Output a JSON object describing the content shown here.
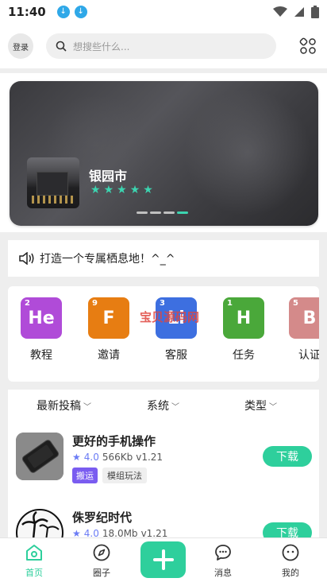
{
  "status": {
    "time": "11:40"
  },
  "header": {
    "login_label": "登录",
    "search_placeholder": "想搜些什么..."
  },
  "banner": {
    "title": "银园市",
    "stars": 5,
    "pages": 4,
    "active_page": 4
  },
  "notice": {
    "text": "打造一个专属栖息地！^_^"
  },
  "categories": [
    {
      "label": "教程",
      "abbr": "He",
      "num": "2",
      "color": "#b04bd8"
    },
    {
      "label": "邀请",
      "abbr": "F",
      "num": "9",
      "color": "#e77d12"
    },
    {
      "label": "客服",
      "abbr": "Li",
      "num": "3",
      "color": "#3d6fe0"
    },
    {
      "label": "任务",
      "abbr": "H",
      "num": "1",
      "color": "#4aa83a"
    },
    {
      "label": "认证",
      "abbr": "B",
      "num": "5",
      "color": "#d48a8a"
    }
  ],
  "watermark": "宝贝源码网",
  "filters": {
    "latest": "最新投稿",
    "system": "系统",
    "type": "类型"
  },
  "items": [
    {
      "title": "更好的手机操作",
      "rating": "4.0",
      "size": "566Kb",
      "version": "v1.21",
      "tags": [
        "搬运",
        "模组玩法"
      ],
      "action": "下载"
    },
    {
      "title": "侏罗纪时代",
      "rating": "4.0",
      "size": "18.0Mb",
      "version": "v1.21",
      "tags": [],
      "action": "下载"
    }
  ],
  "nav": [
    {
      "label": "首页",
      "icon": "home-icon"
    },
    {
      "label": "圈子",
      "icon": "compass-icon"
    },
    {
      "label": "",
      "icon": "plus-icon"
    },
    {
      "label": "消息",
      "icon": "message-icon"
    },
    {
      "label": "我的",
      "icon": "profile-icon"
    }
  ],
  "colors": {
    "accent": "#2ecf9c",
    "star_teal": "#3cd4b0",
    "rating_purple": "#6b7cf5",
    "tag_purple": "#7a5cf0"
  }
}
